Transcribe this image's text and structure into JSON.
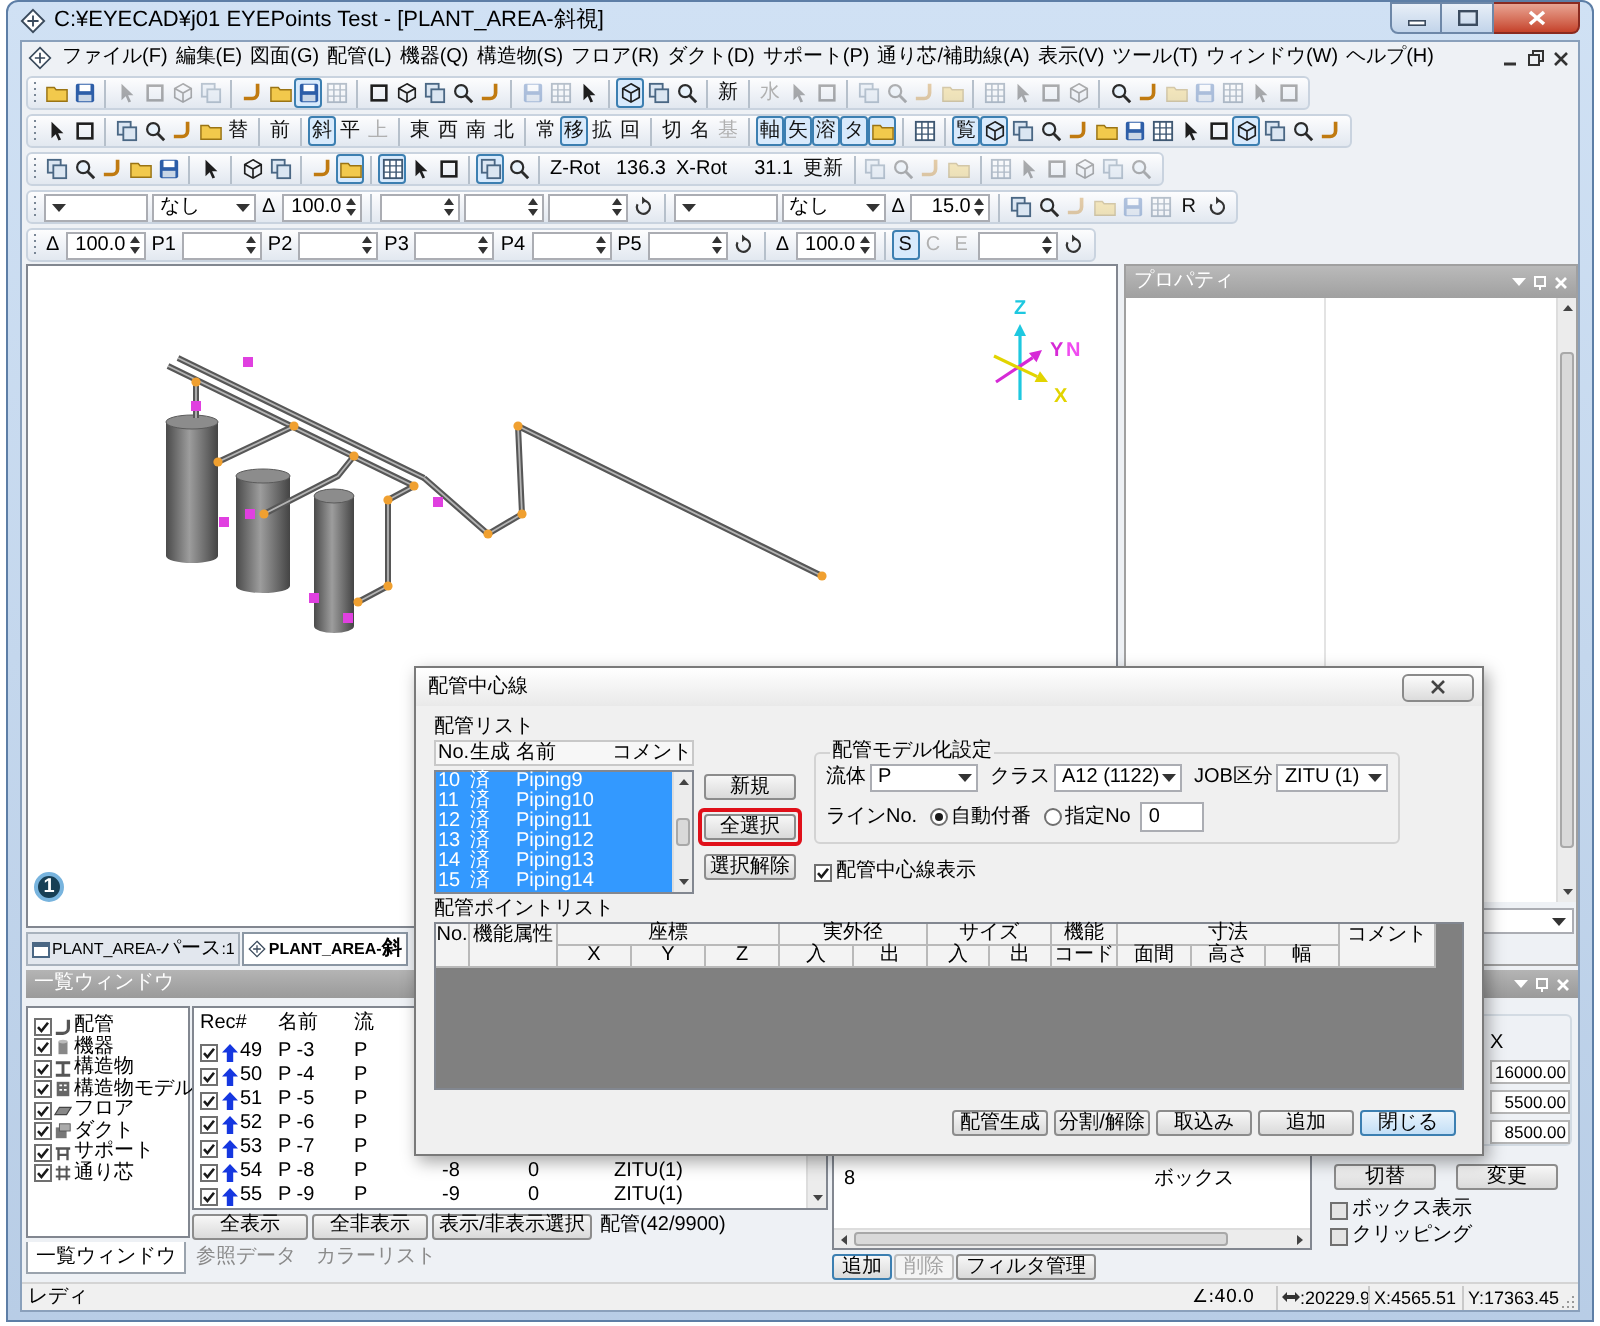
{
  "window": {
    "title": "C:¥EYECAD¥j01 EYEPoints Test - [PLANT_AREA-斜視]"
  },
  "menu": [
    "ファイル(F)",
    "編集(E)",
    "図面(G)",
    "配管(L)",
    "機器(Q)",
    "構造物(S)",
    "フロア(R)",
    "ダクト(D)",
    "サポート(P)",
    "通り芯/補助線(A)",
    "表示(V)",
    "ツール(T)",
    "ウィンドウ(W)",
    "ヘルプ(H)"
  ],
  "toolbars": [
    [
      {
        "kind": "icon",
        "pressed": false,
        "disabled": false
      },
      {
        "kind": "icon",
        "pressed": false,
        "disabled": false
      },
      {
        "kind": "sep"
      },
      {
        "kind": "icon",
        "pressed": false,
        "disabled": true
      },
      {
        "kind": "icon",
        "pressed": false,
        "disabled": true
      },
      {
        "kind": "icon",
        "pressed": false,
        "disabled": true
      },
      {
        "kind": "icon",
        "pressed": false,
        "disabled": true
      },
      {
        "kind": "sep"
      },
      {
        "kind": "icon",
        "pressed": false,
        "disabled": false
      },
      {
        "kind": "icon",
        "pressed": false,
        "disabled": false
      },
      {
        "kind": "icon",
        "pressed": true,
        "disabled": false
      },
      {
        "kind": "icon",
        "pressed": false,
        "disabled": true
      },
      {
        "kind": "sep"
      },
      {
        "kind": "icon",
        "pressed": false,
        "disabled": false
      },
      {
        "kind": "icon",
        "pressed": false,
        "disabled": false
      },
      {
        "kind": "icon",
        "pressed": false,
        "disabled": false
      },
      {
        "kind": "icon",
        "pressed": false,
        "disabled": false
      },
      {
        "kind": "icon",
        "pressed": false,
        "disabled": false
      },
      {
        "kind": "sep"
      },
      {
        "kind": "icon",
        "pressed": false,
        "disabled": true
      },
      {
        "kind": "icon",
        "pressed": false,
        "disabled": true
      },
      {
        "kind": "icon",
        "pressed": false,
        "disabled": false
      },
      {
        "kind": "sep"
      },
      {
        "kind": "icon",
        "pressed": true,
        "disabled": false
      },
      {
        "kind": "icon",
        "pressed": false,
        "disabled": false
      },
      {
        "kind": "icon",
        "pressed": false,
        "disabled": false
      },
      {
        "kind": "sep"
      },
      {
        "kind": "glyph",
        "label": "新",
        "pressed": false,
        "disabled": false
      },
      {
        "kind": "sep"
      },
      {
        "kind": "glyph",
        "label": "水",
        "pressed": false,
        "disabled": true
      },
      {
        "kind": "icon",
        "pressed": false,
        "disabled": true
      },
      {
        "kind": "icon",
        "pressed": false,
        "disabled": true
      },
      {
        "kind": "sep"
      },
      {
        "kind": "icon",
        "pressed": false,
        "disabled": true
      },
      {
        "kind": "icon",
        "pressed": false,
        "disabled": true
      },
      {
        "kind": "icon",
        "pressed": false,
        "disabled": true
      },
      {
        "kind": "icon",
        "pressed": false,
        "disabled": true
      },
      {
        "kind": "sep"
      },
      {
        "kind": "icon",
        "pressed": false,
        "disabled": true
      },
      {
        "kind": "icon",
        "pressed": false,
        "disabled": true
      },
      {
        "kind": "icon",
        "pressed": false,
        "disabled": true
      },
      {
        "kind": "icon",
        "pressed": false,
        "disabled": true
      },
      {
        "kind": "sep"
      },
      {
        "kind": "icon",
        "pressed": false,
        "disabled": false
      },
      {
        "kind": "icon",
        "pressed": false,
        "disabled": false
      },
      {
        "kind": "icon",
        "pressed": false,
        "disabled": true
      },
      {
        "kind": "icon",
        "pressed": false,
        "disabled": true
      },
      {
        "kind": "icon",
        "pressed": false,
        "disabled": true
      },
      {
        "kind": "icon",
        "pressed": false,
        "disabled": true
      },
      {
        "kind": "icon",
        "pressed": false,
        "disabled": true
      }
    ],
    [
      {
        "kind": "icon",
        "pressed": false,
        "disabled": false
      },
      {
        "kind": "icon",
        "pressed": false,
        "disabled": false
      },
      {
        "kind": "sep"
      },
      {
        "kind": "icon",
        "pressed": false,
        "disabled": false
      },
      {
        "kind": "icon",
        "pressed": false,
        "disabled": false
      },
      {
        "kind": "icon",
        "pressed": false,
        "disabled": false
      },
      {
        "kind": "icon",
        "pressed": false,
        "disabled": false
      },
      {
        "kind": "glyph",
        "label": "替",
        "pressed": false,
        "disabled": false
      },
      {
        "kind": "sep"
      },
      {
        "kind": "glyph",
        "label": "前",
        "pressed": false,
        "disabled": false
      },
      {
        "kind": "sep"
      },
      {
        "kind": "glyph",
        "label": "斜",
        "pressed": true,
        "disabled": false
      },
      {
        "kind": "glyph",
        "label": "平",
        "pressed": false,
        "disabled": false
      },
      {
        "kind": "glyph",
        "label": "上",
        "pressed": false,
        "disabled": true
      },
      {
        "kind": "sep"
      },
      {
        "kind": "glyph",
        "label": "東",
        "pressed": false,
        "disabled": false
      },
      {
        "kind": "glyph",
        "label": "西",
        "pressed": false,
        "disabled": false
      },
      {
        "kind": "glyph",
        "label": "南",
        "pressed": false,
        "disabled": false
      },
      {
        "kind": "glyph",
        "label": "北",
        "pressed": false,
        "disabled": false
      },
      {
        "kind": "sep"
      },
      {
        "kind": "glyph",
        "label": "常",
        "pressed": false,
        "disabled": false
      },
      {
        "kind": "glyph",
        "label": "移",
        "pressed": true,
        "disabled": false
      },
      {
        "kind": "glyph",
        "label": "拡",
        "pressed": false,
        "disabled": false
      },
      {
        "kind": "glyph",
        "label": "回",
        "pressed": false,
        "disabled": false
      },
      {
        "kind": "sep"
      },
      {
        "kind": "glyph",
        "label": "切",
        "pressed": false,
        "disabled": false
      },
      {
        "kind": "glyph",
        "label": "名",
        "pressed": false,
        "disabled": false
      },
      {
        "kind": "glyph",
        "label": "基",
        "pressed": false,
        "disabled": true
      },
      {
        "kind": "sep"
      },
      {
        "kind": "glyph",
        "label": "軸",
        "pressed": true,
        "disabled": false
      },
      {
        "kind": "glyph",
        "label": "矢",
        "pressed": true,
        "disabled": false
      },
      {
        "kind": "glyph",
        "label": "溶",
        "pressed": true,
        "disabled": false
      },
      {
        "kind": "glyph",
        "label": "タ",
        "pressed": true,
        "disabled": false
      },
      {
        "kind": "icon",
        "pressed": true,
        "disabled": false
      },
      {
        "kind": "sep"
      },
      {
        "kind": "icon",
        "pressed": false,
        "disabled": false
      },
      {
        "kind": "sep"
      },
      {
        "kind": "glyph",
        "label": "覧",
        "pressed": true,
        "disabled": false
      },
      {
        "kind": "icon",
        "pressed": true,
        "disabled": false
      },
      {
        "kind": "icon",
        "pressed": false,
        "disabled": false
      },
      {
        "kind": "icon",
        "pressed": false,
        "disabled": false
      },
      {
        "kind": "icon",
        "pressed": false,
        "disabled": false
      },
      {
        "kind": "icon",
        "pressed": false,
        "disabled": false
      },
      {
        "kind": "icon",
        "pressed": false,
        "disabled": false
      },
      {
        "kind": "icon",
        "pressed": false,
        "disabled": false
      },
      {
        "kind": "icon",
        "pressed": false,
        "disabled": false
      },
      {
        "kind": "icon",
        "pressed": false,
        "disabled": false
      },
      {
        "kind": "icon",
        "pressed": true,
        "disabled": false
      },
      {
        "kind": "icon",
        "pressed": false,
        "disabled": false
      },
      {
        "kind": "icon",
        "pressed": false,
        "disabled": false
      },
      {
        "kind": "icon",
        "pressed": false,
        "disabled": false
      }
    ],
    [
      {
        "kind": "icon",
        "pressed": false,
        "disabled": false
      },
      {
        "kind": "icon",
        "pressed": false,
        "disabled": false
      },
      {
        "kind": "icon",
        "pressed": false,
        "disabled": false
      },
      {
        "kind": "icon",
        "pressed": false,
        "disabled": false
      },
      {
        "kind": "icon",
        "pressed": false,
        "disabled": false
      },
      {
        "kind": "sep"
      },
      {
        "kind": "icon",
        "pressed": false,
        "disabled": false
      },
      {
        "kind": "sep"
      },
      {
        "kind": "icon",
        "pressed": false,
        "disabled": false
      },
      {
        "kind": "icon",
        "pressed": false,
        "disabled": false
      },
      {
        "kind": "sep"
      },
      {
        "kind": "icon",
        "pressed": false,
        "disabled": false
      },
      {
        "kind": "icon",
        "pressed": true,
        "disabled": false
      },
      {
        "kind": "sep"
      },
      {
        "kind": "icon",
        "pressed": true,
        "disabled": false
      },
      {
        "kind": "icon",
        "pressed": false,
        "disabled": false
      },
      {
        "kind": "icon",
        "pressed": false,
        "disabled": false
      },
      {
        "kind": "sep"
      },
      {
        "kind": "icon",
        "pressed": true,
        "disabled": false
      },
      {
        "kind": "icon",
        "pressed": false,
        "disabled": false
      },
      {
        "kind": "sep"
      },
      {
        "kind": "label",
        "text": "Z-Rot"
      },
      {
        "kind": "value",
        "text": "136.3"
      },
      {
        "kind": "label",
        "text": "X-Rot"
      },
      {
        "kind": "value",
        "text": "31.1"
      },
      {
        "kind": "glyph",
        "label": "更新",
        "pressed": false,
        "disabled": false
      },
      {
        "kind": "sep"
      },
      {
        "kind": "icon",
        "pressed": false,
        "disabled": true
      },
      {
        "kind": "icon",
        "pressed": false,
        "disabled": true
      },
      {
        "kind": "icon",
        "pressed": false,
        "disabled": true
      },
      {
        "kind": "icon",
        "pressed": false,
        "disabled": true
      },
      {
        "kind": "sep"
      },
      {
        "kind": "icon",
        "pressed": false,
        "disabled": true
      },
      {
        "kind": "icon",
        "pressed": false,
        "disabled": true
      },
      {
        "kind": "icon",
        "pressed": false,
        "disabled": true
      },
      {
        "kind": "icon",
        "pressed": false,
        "disabled": true
      },
      {
        "kind": "icon",
        "pressed": false,
        "disabled": true
      },
      {
        "kind": "icon",
        "pressed": false,
        "disabled": true
      }
    ],
    [
      {
        "kind": "combo"
      },
      {
        "kind": "combo",
        "value": "なし"
      },
      {
        "kind": "label",
        "text": "Δ"
      },
      {
        "kind": "spin",
        "value": "100.0"
      },
      {
        "kind": "sep"
      },
      {
        "kind": "spin"
      },
      {
        "kind": "spin"
      },
      {
        "kind": "spin"
      },
      {
        "kind": "reset",
        "pressed": false,
        "disabled": false
      },
      {
        "kind": "sep"
      },
      {
        "kind": "combo"
      },
      {
        "kind": "combo",
        "value": "なし"
      },
      {
        "kind": "label",
        "text": "Δ"
      },
      {
        "kind": "spin",
        "value": "15.0"
      },
      {
        "kind": "sep"
      },
      {
        "kind": "icon",
        "pressed": false,
        "disabled": false
      },
      {
        "kind": "icon",
        "pressed": false,
        "disabled": false
      },
      {
        "kind": "icon",
        "pressed": false,
        "disabled": true
      },
      {
        "kind": "icon",
        "pressed": false,
        "disabled": true
      },
      {
        "kind": "icon",
        "pressed": false,
        "disabled": true
      },
      {
        "kind": "icon",
        "pressed": false,
        "disabled": true
      },
      {
        "kind": "glyph",
        "label": "R",
        "pressed": false,
        "disabled": false
      },
      {
        "kind": "reset",
        "pressed": false,
        "disabled": false
      }
    ],
    [
      {
        "kind": "label",
        "text": "Δ"
      },
      {
        "kind": "spin",
        "value": "100.0"
      },
      {
        "kind": "label",
        "text": "P1"
      },
      {
        "kind": "spin"
      },
      {
        "kind": "label",
        "text": "P2"
      },
      {
        "kind": "spin"
      },
      {
        "kind": "label",
        "text": "P3"
      },
      {
        "kind": "spin"
      },
      {
        "kind": "label",
        "text": "P4"
      },
      {
        "kind": "spin"
      },
      {
        "kind": "label",
        "text": "P5"
      },
      {
        "kind": "spin"
      },
      {
        "kind": "reset",
        "pressed": false,
        "disabled": false
      },
      {
        "kind": "sep"
      },
      {
        "kind": "label",
        "text": "Δ"
      },
      {
        "kind": "spin",
        "value": "100.0"
      },
      {
        "kind": "sep"
      },
      {
        "kind": "glyph",
        "label": "S",
        "pressed": true,
        "disabled": false
      },
      {
        "kind": "glyph",
        "label": "C",
        "pressed": false,
        "disabled": true
      },
      {
        "kind": "glyph",
        "label": "E",
        "pressed": false,
        "disabled": true
      },
      {
        "kind": "spin"
      },
      {
        "kind": "reset",
        "pressed": false,
        "disabled": false
      }
    ]
  ],
  "viewport": {
    "axes": [
      {
        "kind": "axis",
        "label": "Z",
        "color": "#1ec8e0"
      },
      {
        "kind": "axis",
        "label": "Y",
        "color": "#d62ad6"
      },
      {
        "kind": "north",
        "label": "N",
        "color": "#f04cf0"
      },
      {
        "kind": "axis",
        "label": "X",
        "color": "#e2d400"
      }
    ],
    "badge": "1"
  },
  "properties": {
    "title": "プロパティ"
  },
  "doc_tabs": [
    {
      "label": "PLANT_AREA-パース:1",
      "selected": false
    },
    {
      "label": "PLANT_AREA-斜",
      "selected": true
    }
  ],
  "dialog": {
    "title": "配管中心線",
    "pipe_list": {
      "title": "配管リスト",
      "columns": [
        "No.",
        "生成",
        "名前",
        "コメント"
      ],
      "rows": [
        {
          "cells": [
            "10",
            "済",
            "Piping9"
          ],
          "selected": true
        },
        {
          "cells": [
            "11",
            "済",
            "Piping10"
          ],
          "selected": true
        },
        {
          "cells": [
            "12",
            "済",
            "Piping11"
          ],
          "selected": true
        },
        {
          "cells": [
            "13",
            "済",
            "Piping12"
          ],
          "selected": true
        },
        {
          "cells": [
            "14",
            "済",
            "Piping13"
          ],
          "selected": true
        },
        {
          "cells": [
            "15",
            "済",
            "Piping14"
          ],
          "selected": true
        }
      ]
    },
    "list_buttons": [
      {
        "label": "新規",
        "highlighted": false
      },
      {
        "label": "全選択",
        "highlighted": true
      },
      {
        "label": "選択解除",
        "highlighted": false
      }
    ],
    "model_settings": {
      "title": "配管モデル化設定",
      "fields": [
        {
          "label": "流体",
          "value": "P"
        },
        {
          "label": "クラス",
          "value": "A12 (1122)"
        },
        {
          "label": "JOB区分",
          "value": "ZITU (1)"
        }
      ],
      "line_no": {
        "label": "ラインNo.",
        "options": [
          {
            "label": "自動付番",
            "selected": true
          },
          {
            "label": "指定No",
            "selected": false
          }
        ],
        "value": "0"
      }
    },
    "show_centerline": {
      "label": "配管中心線表示",
      "checked": true
    },
    "point_list": {
      "title": "配管ポイントリスト",
      "columns": [
        {
          "label": "No."
        },
        {
          "label": "機能属性"
        },
        {
          "label": "座標",
          "sub": [
            "X",
            "Y",
            "Z"
          ]
        },
        {
          "label": "実外径",
          "sub": [
            "入",
            "出"
          ]
        },
        {
          "label": "サイズ",
          "sub": [
            "入",
            "出"
          ]
        },
        {
          "label": "機能",
          "sub": [
            "コード"
          ]
        },
        {
          "label": "寸法",
          "sub": [
            "面間",
            "高さ",
            "幅"
          ]
        },
        {
          "label": "コメント"
        }
      ]
    },
    "buttons": [
      {
        "label": "配管生成",
        "default": false
      },
      {
        "label": "分割/解除",
        "default": false
      },
      {
        "label": "取込み",
        "default": false
      },
      {
        "label": "追加",
        "default": false
      },
      {
        "label": "閉じる",
        "default": true
      }
    ]
  },
  "list_window": {
    "title": "一覧ウィンドウ",
    "categories": [
      {
        "label": "配管",
        "checked": true
      },
      {
        "label": "機器",
        "checked": true
      },
      {
        "label": "構造物",
        "checked": true
      },
      {
        "label": "構造物モデル",
        "checked": true
      },
      {
        "label": "フロア",
        "checked": true
      },
      {
        "label": "ダクト",
        "checked": true
      },
      {
        "label": "サポート",
        "checked": true
      },
      {
        "label": "通り芯",
        "checked": true
      }
    ],
    "table": {
      "columns": [
        "Rec#",
        "名前",
        "流"
      ],
      "rows": [
        {
          "checked": true,
          "cells": [
            "49",
            "P -3",
            "P"
          ]
        },
        {
          "checked": true,
          "cells": [
            "50",
            "P -4",
            "P"
          ]
        },
        {
          "checked": true,
          "cells": [
            "51",
            "P -5",
            "P"
          ]
        },
        {
          "checked": true,
          "cells": [
            "52",
            "P -6",
            "P"
          ]
        },
        {
          "checked": true,
          "cells": [
            "53",
            "P -7",
            "P"
          ]
        },
        {
          "checked": true,
          "cells": [
            "54",
            "P -8",
            "P",
            "-8",
            "0",
            "ZITU(1)"
          ]
        },
        {
          "checked": true,
          "cells": [
            "55",
            "P -9",
            "P",
            "-9",
            "0",
            "ZITU(1)"
          ]
        }
      ]
    },
    "buttons": [
      "全表示",
      "全非表示",
      "表示/非表示選択"
    ],
    "count": "配管(42/9900)",
    "tabs": [
      {
        "label": "一覧ウィンドウ",
        "selected": true
      },
      {
        "label": "参照データ",
        "selected": false
      },
      {
        "label": "カラーリスト",
        "selected": false
      }
    ]
  },
  "filter_list": {
    "rows": [
      {
        "cells": [
          "8",
          "ボックス"
        ]
      }
    ],
    "buttons": [
      {
        "label": "追加",
        "focused": true,
        "disabled": false
      },
      {
        "label": "削除",
        "focused": false,
        "disabled": true
      },
      {
        "label": "フィルタ管理",
        "focused": false,
        "disabled": false
      }
    ]
  },
  "clip_box": {
    "column_label": "X",
    "values": [
      "16000.00",
      "5500.00",
      "8500.00"
    ],
    "buttons": [
      "切替",
      "変更"
    ],
    "checks": [
      {
        "label": "ボックス表示",
        "checked": false
      },
      {
        "label": "クリッピング",
        "checked": false
      }
    ]
  },
  "status_bar": {
    "message": "レディ",
    "angle": "∠:40.0",
    "distance": ":20229.9",
    "x": "X:4565.51",
    "y": "Y:17363.45"
  }
}
